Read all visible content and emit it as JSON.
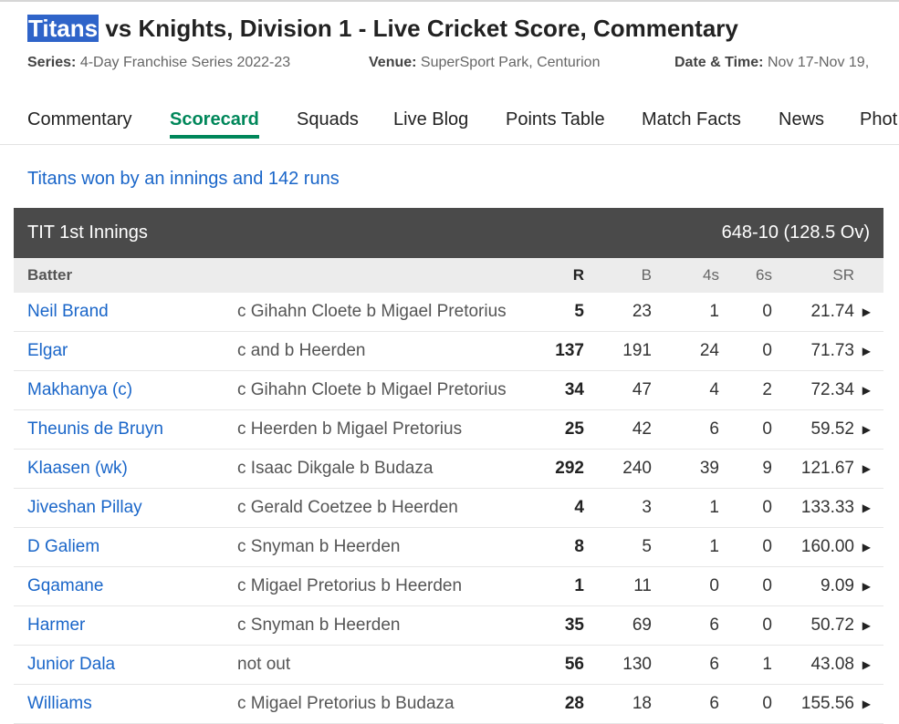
{
  "header": {
    "title_highlight": "Titans",
    "title_rest": " vs Knights, Division 1 - Live Cricket Score, Commentary",
    "series_label": "Series:",
    "series_value": "4-Day Franchise Series 2022-23",
    "venue_label": "Venue:",
    "venue_value": "SuperSport Park, Centurion",
    "date_label": "Date & Time:",
    "date_value": "Nov 17-Nov 19,"
  },
  "tabs": [
    {
      "label": "Commentary"
    },
    {
      "label": "Scorecard"
    },
    {
      "label": "Squads"
    },
    {
      "label": "Live Blog"
    },
    {
      "label": "Points Table"
    },
    {
      "label": "Match Facts"
    },
    {
      "label": "News"
    },
    {
      "label": "Phot"
    }
  ],
  "active_tab": "Scorecard",
  "result": "Titans won by an innings and 142 runs",
  "innings": {
    "name": "TIT 1st Innings",
    "total": "648-10 (128.5 Ov)",
    "columns": {
      "batter": "Batter",
      "r": "R",
      "b": "B",
      "fours": "4s",
      "sixes": "6s",
      "sr": "SR"
    },
    "batters": [
      {
        "name": "Neil Brand",
        "dismissal": "c Gihahn Cloete b Migael Pretorius",
        "r": "5",
        "b": "23",
        "fours": "1",
        "sixes": "0",
        "sr": "21.74"
      },
      {
        "name": "Elgar",
        "dismissal": "c and b Heerden",
        "r": "137",
        "b": "191",
        "fours": "24",
        "sixes": "0",
        "sr": "71.73"
      },
      {
        "name": "Makhanya (c)",
        "dismissal": "c Gihahn Cloete b Migael Pretorius",
        "r": "34",
        "b": "47",
        "fours": "4",
        "sixes": "2",
        "sr": "72.34"
      },
      {
        "name": "Theunis de Bruyn",
        "dismissal": "c Heerden b Migael Pretorius",
        "r": "25",
        "b": "42",
        "fours": "6",
        "sixes": "0",
        "sr": "59.52"
      },
      {
        "name": "Klaasen (wk)",
        "dismissal": "c Isaac Dikgale b Budaza",
        "r": "292",
        "b": "240",
        "fours": "39",
        "sixes": "9",
        "sr": "121.67"
      },
      {
        "name": "Jiveshan Pillay",
        "dismissal": "c Gerald Coetzee b Heerden",
        "r": "4",
        "b": "3",
        "fours": "1",
        "sixes": "0",
        "sr": "133.33"
      },
      {
        "name": "D Galiem",
        "dismissal": "c Snyman b Heerden",
        "r": "8",
        "b": "5",
        "fours": "1",
        "sixes": "0",
        "sr": "160.00"
      },
      {
        "name": "Gqamane",
        "dismissal": "c Migael Pretorius b Heerden",
        "r": "1",
        "b": "11",
        "fours": "0",
        "sixes": "0",
        "sr": "9.09"
      },
      {
        "name": "Harmer",
        "dismissal": "c Snyman b Heerden",
        "r": "35",
        "b": "69",
        "fours": "6",
        "sixes": "0",
        "sr": "50.72"
      },
      {
        "name": "Junior Dala",
        "dismissal": "not out",
        "r": "56",
        "b": "130",
        "fours": "6",
        "sixes": "1",
        "sr": "43.08"
      },
      {
        "name": "Williams",
        "dismissal": "c Migael Pretorius b Budaza",
        "r": "28",
        "b": "18",
        "fours": "6",
        "sixes": "0",
        "sr": "155.56"
      }
    ]
  },
  "icons": {
    "expand": "caret-right-icon"
  }
}
